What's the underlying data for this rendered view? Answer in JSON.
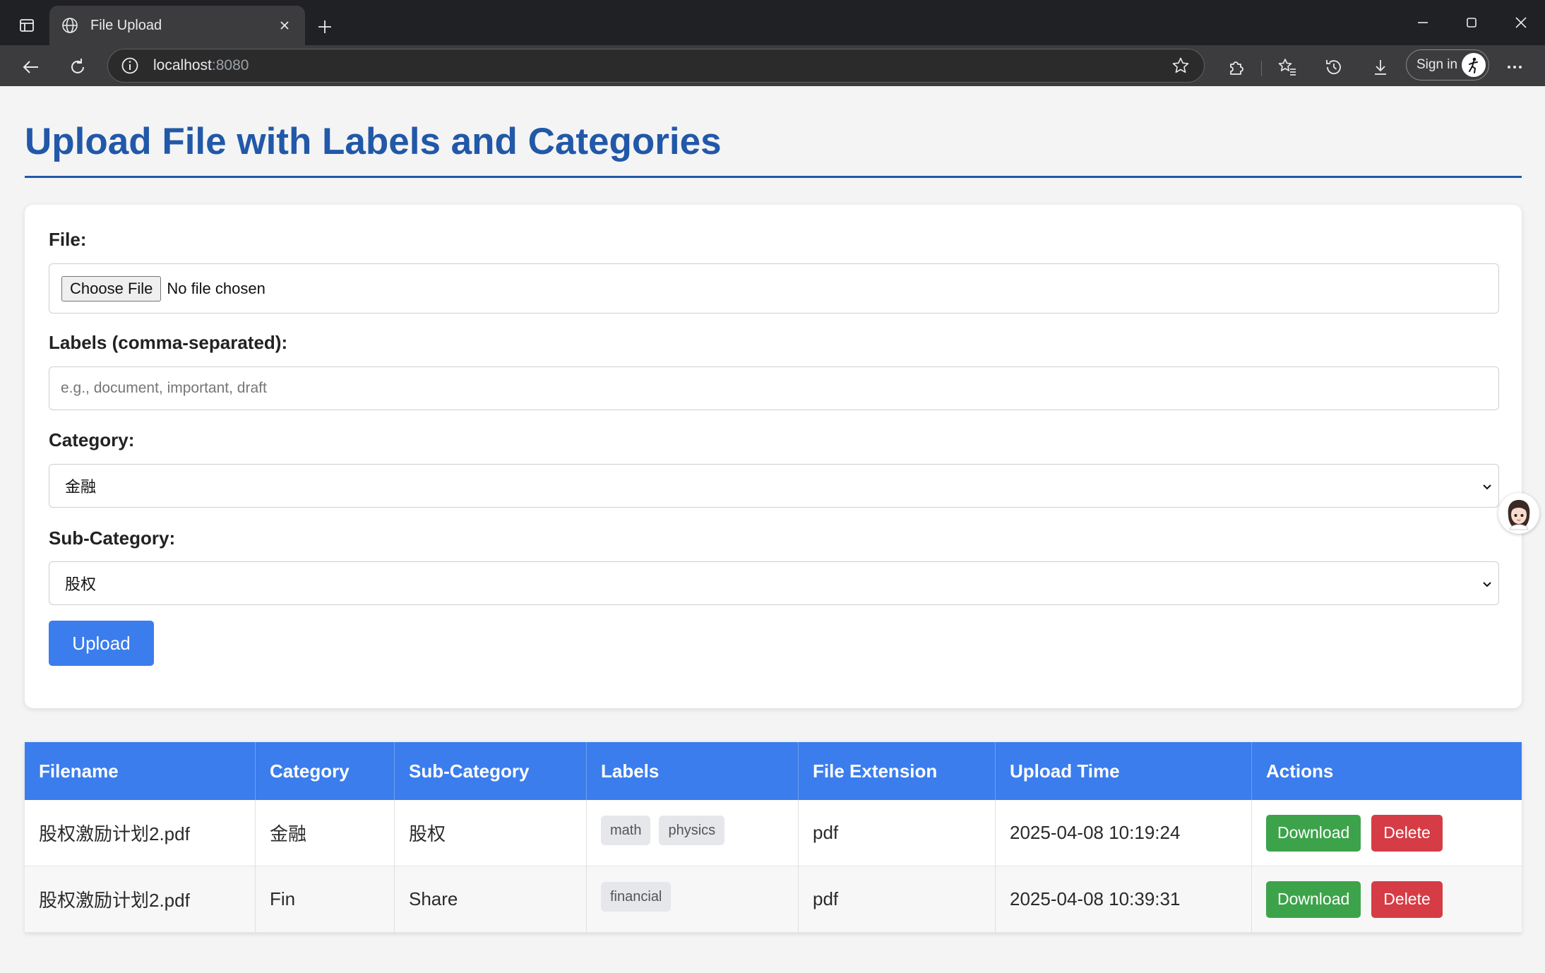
{
  "browser": {
    "tab_title": "File Upload",
    "url_host": "localhost",
    "url_port": ":8080",
    "signin_label": "Sign in"
  },
  "page": {
    "title": "Upload File with Labels and Categories"
  },
  "form": {
    "file_label": "File:",
    "choose_file_label": "Choose File",
    "no_file_text": "No file chosen",
    "labels_label": "Labels (comma-separated):",
    "labels_placeholder": "e.g., document, important, draft",
    "category_label": "Category:",
    "category_value": "金融",
    "subcategory_label": "Sub-Category:",
    "subcategory_value": "股权",
    "upload_label": "Upload"
  },
  "table": {
    "headers": [
      "Filename",
      "Category",
      "Sub-Category",
      "Labels",
      "File Extension",
      "Upload Time",
      "Actions"
    ],
    "rows": [
      {
        "filename": "股权激励计划2.pdf",
        "category": "金融",
        "subcategory": "股权",
        "labels": [
          "math",
          "physics"
        ],
        "extension": "pdf",
        "upload_time": "2025-04-08 10:19:24",
        "download_label": "Download",
        "delete_label": "Delete"
      },
      {
        "filename": "股权激励计划2.pdf",
        "category": "Fin",
        "subcategory": "Share",
        "labels": [
          "financial"
        ],
        "extension": "pdf",
        "upload_time": "2025-04-08 10:39:31",
        "download_label": "Download",
        "delete_label": "Delete"
      }
    ]
  },
  "colors": {
    "accent": "#3b7ded",
    "title": "#2158a8",
    "download": "#3da34b",
    "delete": "#d63c45"
  }
}
